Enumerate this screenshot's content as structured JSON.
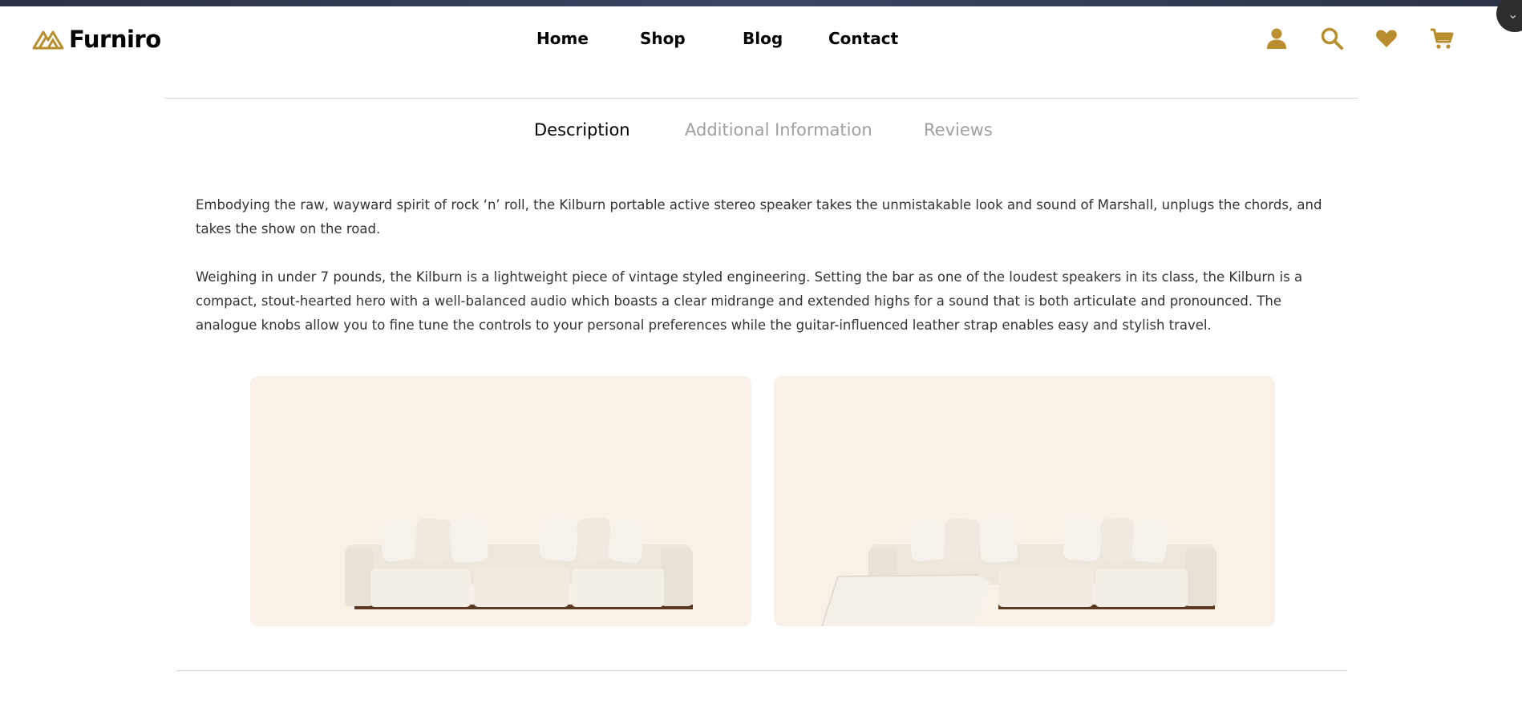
{
  "brand": {
    "name": "Furniro",
    "accent": "#B88E2F"
  },
  "nav": {
    "items": [
      {
        "label": "Home"
      },
      {
        "label": "Shop"
      },
      {
        "label": "Blog"
      },
      {
        "label": "Contact"
      }
    ]
  },
  "header_icons": [
    "account-icon",
    "search-icon",
    "heart-icon",
    "cart-icon"
  ],
  "tabs": {
    "items": [
      {
        "label": "Description",
        "active": true
      },
      {
        "label": "Additional Information",
        "active": false
      },
      {
        "label": "Reviews",
        "active": false
      }
    ]
  },
  "description": {
    "paragraphs": [
      "Embodying the raw, wayward spirit of rock ‘n’ roll, the Kilburn portable active stereo speaker takes the unmistakable look and sound of Marshall, unplugs the chords, and takes the show on the road.",
      "Weighing in under 7 pounds, the Kilburn is a lightweight piece of vintage styled engineering. Setting the bar as one of the loudest speakers in its class, the Kilburn is a compact, stout-hearted hero with a well-balanced audio which boasts a clear midrange and extended highs for a sound that is both articulate and pronounced. The analogue knobs allow you to fine tune the controls to your personal preferences while the guitar-influenced leather strap enables easy and stylish travel."
    ]
  },
  "colors": {
    "card_bg": "#F9F0E7",
    "inactive_tab": "#9F9F9F",
    "divider": "#D9D9D9"
  }
}
